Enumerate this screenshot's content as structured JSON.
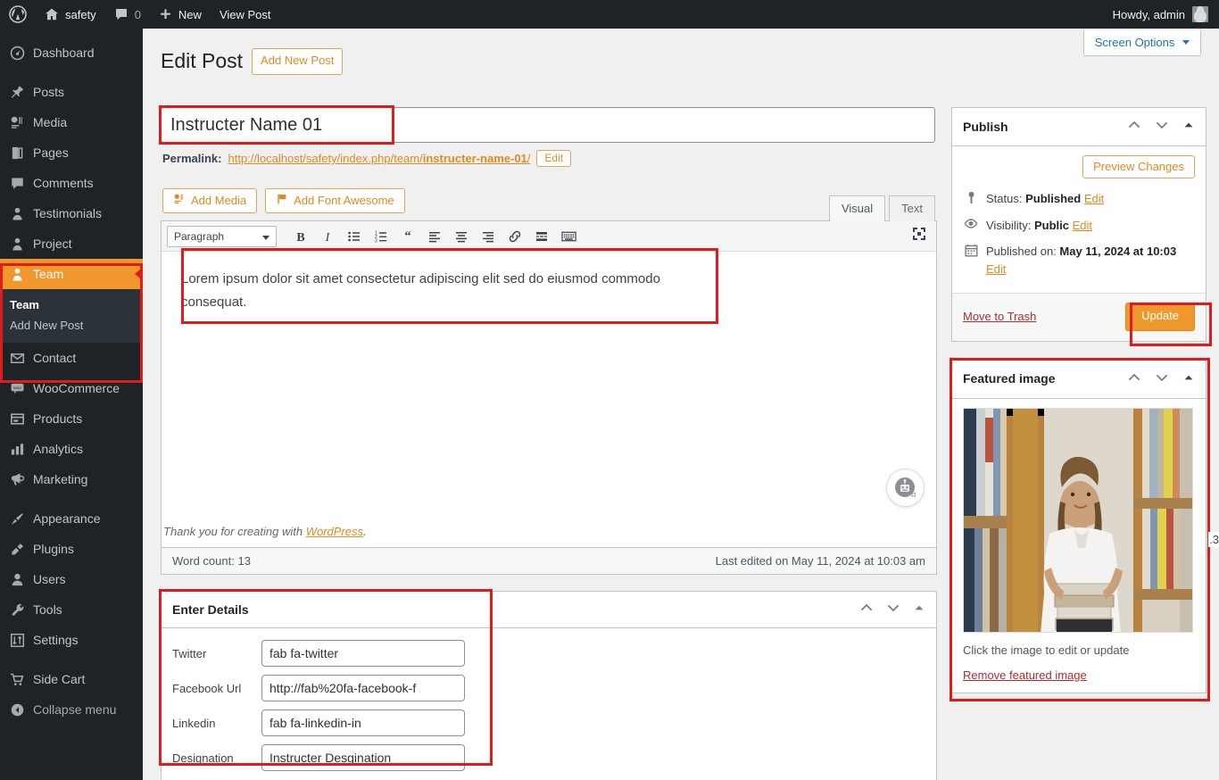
{
  "adminbar": {
    "wp_logo": "wordpress-logo-icon",
    "site_name": "safety",
    "comment_count": "0",
    "new_label": "New",
    "view_post_label": "View Post",
    "howdy": "Howdy, admin"
  },
  "sidebar": {
    "items": [
      {
        "label": "Dashboard",
        "icon": "dashboard-icon",
        "current": false
      },
      {
        "label": "Posts",
        "icon": "pin-icon",
        "current": false
      },
      {
        "label": "Media",
        "icon": "media-icon",
        "current": false
      },
      {
        "label": "Pages",
        "icon": "pages-icon",
        "current": false
      },
      {
        "label": "Comments",
        "icon": "comment-icon",
        "current": false
      },
      {
        "label": "Testimonials",
        "icon": "person-icon",
        "current": false
      },
      {
        "label": "Project",
        "icon": "person-icon",
        "current": false
      },
      {
        "label": "Team",
        "icon": "person-icon",
        "current": true
      },
      {
        "label": "Contact",
        "icon": "envelope-icon",
        "current": false
      },
      {
        "label": "WooCommerce",
        "icon": "woo-icon",
        "current": false
      },
      {
        "label": "Products",
        "icon": "products-icon",
        "current": false
      },
      {
        "label": "Analytics",
        "icon": "chart-bar-icon",
        "current": false
      },
      {
        "label": "Marketing",
        "icon": "megaphone-icon",
        "current": false
      },
      {
        "label": "Appearance",
        "icon": "paintbrush-icon",
        "current": false
      },
      {
        "label": "Plugins",
        "icon": "plug-icon",
        "current": false
      },
      {
        "label": "Users",
        "icon": "user-icon",
        "current": false
      },
      {
        "label": "Tools",
        "icon": "wrench-icon",
        "current": false
      },
      {
        "label": "Settings",
        "icon": "sliders-icon",
        "current": false
      },
      {
        "label": "Side Cart",
        "icon": "cart-icon",
        "current": false
      },
      {
        "label": "Collapse menu",
        "icon": "collapse-icon",
        "current": false
      }
    ],
    "submenu": {
      "parent": "Team",
      "items": [
        {
          "label": "Team",
          "current": true
        },
        {
          "label": "Add New Post",
          "current": false
        }
      ]
    }
  },
  "header": {
    "screen_options": "Screen Options",
    "screen_options_caret": "chevron-down-icon",
    "page_title": "Edit Post",
    "add_new_button": "Add New Post"
  },
  "post": {
    "title_value": "Instructer Name 01",
    "title_placeholder": "Add title",
    "permalink_label": "Permalink:",
    "permalink_prefix": "http://localhost/safety/index.php/team/",
    "permalink_slug": "instructer-name-01",
    "permalink_suffix": "/",
    "permalink_edit_button": "Edit"
  },
  "editor": {
    "add_media_button": "Add Media",
    "add_font_awesome_button": "Add Font Awesome",
    "tabs": [
      {
        "label": "Visual",
        "active": true
      },
      {
        "label": "Text",
        "active": false
      }
    ],
    "format_select_value": "Paragraph",
    "toolbar_buttons": [
      "bold-icon",
      "italic-icon",
      "bulleted-list-icon",
      "numbered-list-icon",
      "blockquote-icon",
      "align-left-icon",
      "align-center-icon",
      "align-right-icon",
      "insert-link-icon",
      "read-more-icon",
      "toolbar-toggle-icon"
    ],
    "fullscreen_button": "distraction-free-icon",
    "content": "Lorem ipsum dolor sit amet consectetur adipiscing elit sed do eiusmod commodo consequat.",
    "assistant_button": "robot-assistant-icon",
    "credit_prefix": "Thank you for creating with ",
    "credit_link": "WordPress",
    "credit_suffix": ".",
    "word_count": "Word count: 13",
    "last_edited": "Last edited on May 11, 2024 at 10:03 am"
  },
  "details_box": {
    "title": "Enter Details",
    "handles": [
      "move-up-icon",
      "move-down-icon",
      "toggle-panel-icon"
    ],
    "fields": [
      {
        "label": "Twitter",
        "value": "fab fa-twitter"
      },
      {
        "label": "Facebook Url",
        "value": "http://fab%20fa-facebook-f"
      },
      {
        "label": "Linkedin",
        "value": "fab fa-linkedin-in"
      },
      {
        "label": "Designation",
        "value": "Instructer Desgination"
      }
    ]
  },
  "publish_panel": {
    "title": "Publish",
    "handles": [
      "move-up-icon",
      "move-down-icon",
      "toggle-panel-icon"
    ],
    "preview_button": "Preview Changes",
    "status_label": "Status:",
    "status_value": "Published",
    "status_edit": "Edit",
    "status_icon": "pin-marker-icon",
    "visibility_label": "Visibility:",
    "visibility_value": "Public",
    "visibility_edit": "Edit",
    "visibility_icon": "eye-icon",
    "published_label": "Published on:",
    "published_value": "May 11, 2024 at 10:03",
    "published_edit": "Edit",
    "published_icon": "calendar-icon",
    "trash_link": "Move to Trash",
    "update_button": "Update"
  },
  "featured_image_panel": {
    "title": "Featured image",
    "handles": [
      "move-up-icon",
      "move-down-icon",
      "toggle-panel-icon"
    ],
    "image_alt": "Woman holding a stack of books in a library",
    "caption": "Click the image to edit or update",
    "remove_link": "Remove featured image"
  },
  "misc": {
    "edge_fragment": ".3"
  },
  "colors": {
    "accent_orange": "#f0982d",
    "highlight_red": "#e01b1b",
    "admin_dark": "#1d2327",
    "submenu_dark": "#2c3338",
    "link_orange": "#e08a21",
    "trash_red": "#b32d2e"
  }
}
